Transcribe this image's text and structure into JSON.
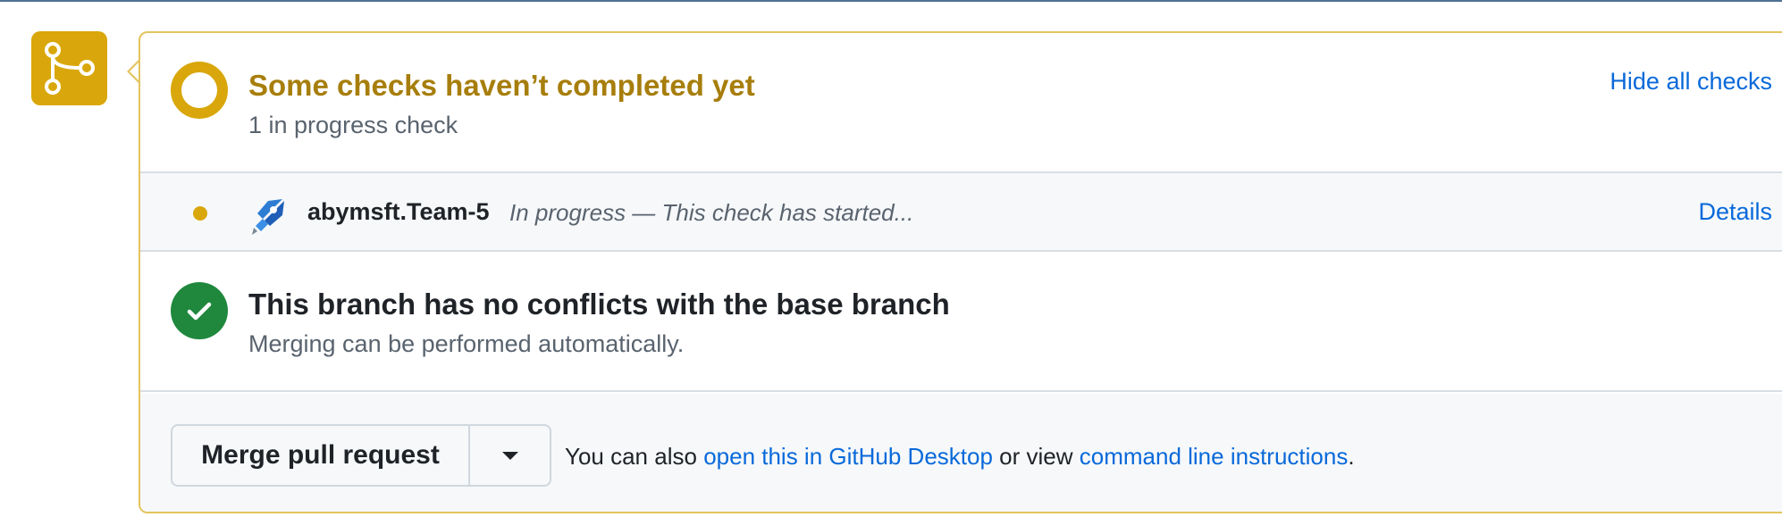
{
  "status": {
    "title": "Some checks haven’t completed yet",
    "subtitle": "1 in progress check",
    "hide_link": "Hide all checks",
    "color": "#d9a70b"
  },
  "check": {
    "app_icon": "azure-pipelines-icon",
    "name": "abymsft.Team-5",
    "description": "In progress — This check has started...",
    "details_link": "Details"
  },
  "conflicts": {
    "title": "This branch has no conflicts with the base branch",
    "subtitle": "Merging can be performed automatically.",
    "color": "#1f883d"
  },
  "merge": {
    "button_label": "Merge pull request",
    "note_prefix": "You can also",
    "desktop_link": "open this in GitHub Desktop",
    "note_middle": "or view",
    "cli_link": "command line instructions",
    "note_suffix": "."
  },
  "colors": {
    "link": "#0969da",
    "pending": "#d9a70b",
    "success": "#1f883d"
  }
}
